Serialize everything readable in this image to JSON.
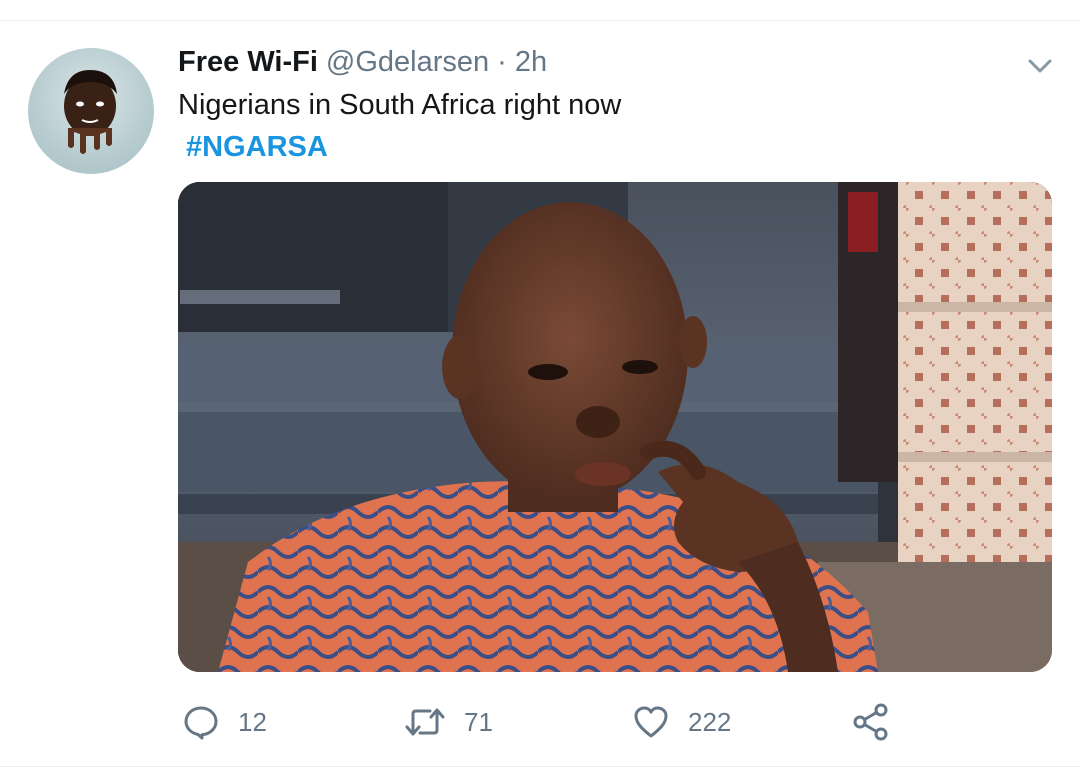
{
  "tweet": {
    "display_name": "Free Wi-Fi",
    "handle": "@Gdelarsen",
    "separator": "·",
    "time": "2h",
    "text": "Nigerians in South Africa right now",
    "hashtag": "#NGARSA"
  },
  "actions": {
    "replies": "12",
    "retweets": "71",
    "likes": "222"
  },
  "colors": {
    "accent": "#1b95e0",
    "muted": "#657786",
    "text": "#14171a",
    "divider": "#e6ecf0"
  },
  "icons": {
    "reply": "reply-icon",
    "retweet": "retweet-icon",
    "like": "heart-icon",
    "share": "share-icon",
    "menu": "chevron-down-icon"
  }
}
